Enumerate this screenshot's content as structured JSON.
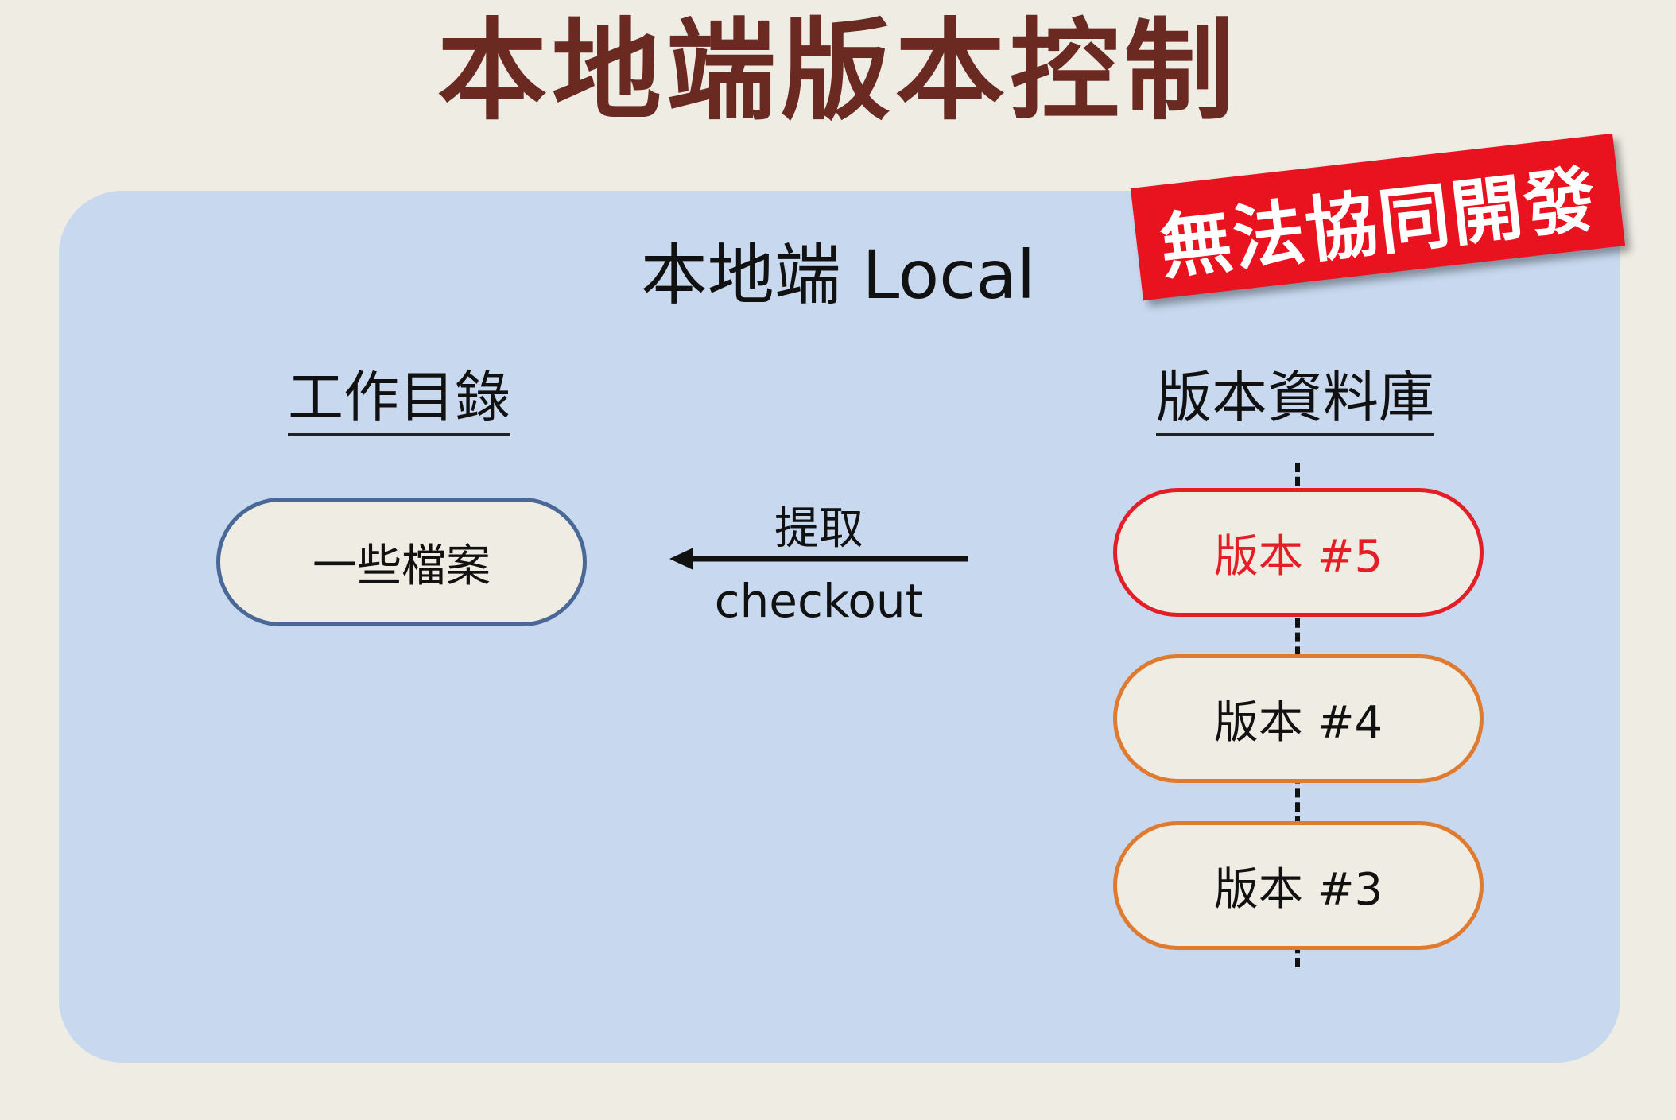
{
  "title": "本地端版本控制",
  "panel": {
    "title": "本地端 Local",
    "stamp": "無法協同開發"
  },
  "working_directory": {
    "heading": "工作目錄",
    "item": "一些檔案"
  },
  "repository": {
    "heading": "版本資料庫",
    "versions": [
      "版本 #5",
      "版本 #4",
      "版本 #3"
    ]
  },
  "arrow": {
    "label_top": "提取",
    "label_bottom": "checkout"
  },
  "colors": {
    "title": "#6a2a22",
    "panel": "#c7d8ef",
    "background": "#efece4",
    "stamp": "#e8131f",
    "current_version": "#e41e26",
    "older_version": "#e07a2e",
    "working_item_border": "#4a6896"
  }
}
